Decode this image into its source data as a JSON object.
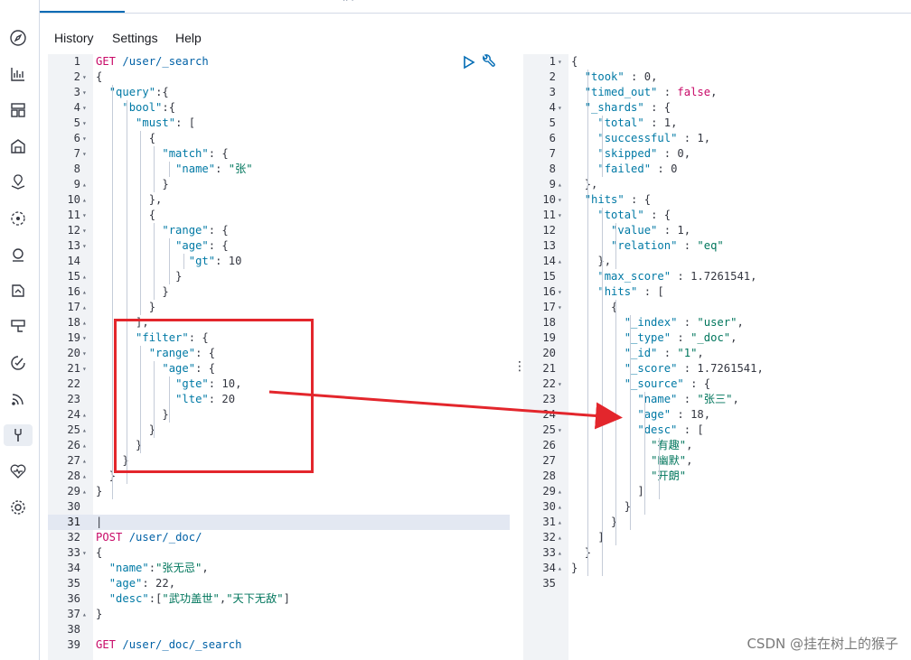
{
  "menu": {
    "history": "History",
    "settings": "Settings",
    "help": "Help"
  },
  "rail_icons": [
    "compass-icon",
    "chart-icon",
    "dashboard-icon",
    "canvas-icon",
    "maps-icon",
    "ml-icon",
    "graph-icon",
    "apm-icon",
    "uptime-icon",
    "siem-icon",
    "signals-icon",
    "devtools-icon",
    "monitoring-icon",
    "management-icon"
  ],
  "request_lines": [
    {
      "n": "1",
      "f": "",
      "html": "<span class='k'>GET</span> <span class='u'>/user/_search</span>"
    },
    {
      "n": "2",
      "f": "▾",
      "html": "<span class='p'>{</span>"
    },
    {
      "n": "3",
      "f": "▾",
      "html": "  <span class='key'>\"query\"</span><span class='p'>:{</span>"
    },
    {
      "n": "4",
      "f": "▾",
      "html": "    <span class='key'>\"bool\"</span><span class='p'>:{</span>"
    },
    {
      "n": "5",
      "f": "▾",
      "html": "      <span class='key'>\"must\"</span><span class='p'>: [</span>"
    },
    {
      "n": "6",
      "f": "▾",
      "html": "        <span class='p'>{</span>"
    },
    {
      "n": "7",
      "f": "▾",
      "html": "          <span class='key'>\"match\"</span><span class='p'>: {</span>"
    },
    {
      "n": "8",
      "f": "",
      "html": "            <span class='key'>\"name\"</span><span class='p'>: </span><span class='str'>\"张\"</span>"
    },
    {
      "n": "9",
      "f": "▴",
      "html": "          <span class='p'>}</span>"
    },
    {
      "n": "10",
      "f": "▴",
      "html": "        <span class='p'>},</span>"
    },
    {
      "n": "11",
      "f": "▾",
      "html": "        <span class='p'>{</span>"
    },
    {
      "n": "12",
      "f": "▾",
      "html": "          <span class='key'>\"range\"</span><span class='p'>: {</span>"
    },
    {
      "n": "13",
      "f": "▾",
      "html": "            <span class='key'>\"age\"</span><span class='p'>: {</span>"
    },
    {
      "n": "14",
      "f": "",
      "html": "              <span class='key'>\"gt\"</span><span class='p'>: 10</span>"
    },
    {
      "n": "15",
      "f": "▴",
      "html": "            <span class='p'>}</span>"
    },
    {
      "n": "16",
      "f": "▴",
      "html": "          <span class='p'>}</span>"
    },
    {
      "n": "17",
      "f": "▴",
      "html": "        <span class='p'>}</span>"
    },
    {
      "n": "18",
      "f": "▴",
      "html": "      <span class='p'>],</span>"
    },
    {
      "n": "19",
      "f": "▾",
      "html": "      <span class='key'>\"filter\"</span><span class='p'>: {</span>"
    },
    {
      "n": "20",
      "f": "▾",
      "html": "        <span class='key'>\"range\"</span><span class='p'>: {</span>"
    },
    {
      "n": "21",
      "f": "▾",
      "html": "          <span class='key'>\"age\"</span><span class='p'>: {</span>"
    },
    {
      "n": "22",
      "f": "",
      "html": "            <span class='key'>\"gte\"</span><span class='p'>: 10,</span>"
    },
    {
      "n": "23",
      "f": "",
      "html": "            <span class='key'>\"lte\"</span><span class='p'>: 20</span>"
    },
    {
      "n": "24",
      "f": "▴",
      "html": "          <span class='p'>}</span>"
    },
    {
      "n": "25",
      "f": "▴",
      "html": "        <span class='p'>}</span>"
    },
    {
      "n": "26",
      "f": "▴",
      "html": "      <span class='p'>}</span>"
    },
    {
      "n": "27",
      "f": "▴",
      "html": "    <span class='p'>}</span>"
    },
    {
      "n": "28",
      "f": "▴",
      "html": "  <span class='p'>}</span>"
    },
    {
      "n": "29",
      "f": "▴",
      "html": "<span class='p'>}</span>"
    },
    {
      "n": "30",
      "f": "",
      "html": ""
    },
    {
      "n": "31",
      "f": "",
      "html": "<span class='p'>|</span>",
      "cursor": true
    },
    {
      "n": "32",
      "f": "",
      "html": "<span class='k'>POST</span> <span class='u'>/user/_doc/</span>"
    },
    {
      "n": "33",
      "f": "▾",
      "html": "<span class='p'>{</span>"
    },
    {
      "n": "34",
      "f": "",
      "html": "  <span class='key'>\"name\"</span><span class='p'>:</span><span class='str'>\"张无忌\"</span><span class='p'>,</span>"
    },
    {
      "n": "35",
      "f": "",
      "html": "  <span class='key'>\"age\"</span><span class='p'>: 22,</span>"
    },
    {
      "n": "36",
      "f": "",
      "html": "  <span class='key'>\"desc\"</span><span class='p'>:[</span><span class='str'>\"武功盖世\"</span><span class='p'>,</span><span class='str'>\"天下无敌\"</span><span class='p'>]</span>"
    },
    {
      "n": "37",
      "f": "▴",
      "html": "<span class='p'>}</span>"
    },
    {
      "n": "38",
      "f": "",
      "html": ""
    },
    {
      "n": "39",
      "f": "",
      "html": "<span class='k'>GET</span> <span class='u'>/user/_doc/_search</span>"
    }
  ],
  "response_lines": [
    {
      "n": "1",
      "f": "▾",
      "html": "<span class='p'>{</span>"
    },
    {
      "n": "2",
      "f": "",
      "html": "  <span class='rkey'>\"took\"</span><span class='p'> : 0,</span>"
    },
    {
      "n": "3",
      "f": "",
      "html": "  <span class='rkey'>\"timed_out\"</span><span class='p'> : </span><span class='bool'>false</span><span class='p'>,</span>"
    },
    {
      "n": "4",
      "f": "▾",
      "html": "  <span class='rkey'>\"_shards\"</span><span class='p'> : {</span>"
    },
    {
      "n": "5",
      "f": "",
      "html": "    <span class='rkey'>\"total\"</span><span class='p'> : 1,</span>"
    },
    {
      "n": "6",
      "f": "",
      "html": "    <span class='rkey'>\"successful\"</span><span class='p'> : 1,</span>"
    },
    {
      "n": "7",
      "f": "",
      "html": "    <span class='rkey'>\"skipped\"</span><span class='p'> : 0,</span>"
    },
    {
      "n": "8",
      "f": "",
      "html": "    <span class='rkey'>\"failed\"</span><span class='p'> : 0</span>"
    },
    {
      "n": "9",
      "f": "▴",
      "html": "  <span class='p'>},</span>"
    },
    {
      "n": "10",
      "f": "▾",
      "html": "  <span class='rkey'>\"hits\"</span><span class='p'> : {</span>"
    },
    {
      "n": "11",
      "f": "▾",
      "html": "    <span class='rkey'>\"total\"</span><span class='p'> : {</span>"
    },
    {
      "n": "12",
      "f": "",
      "html": "      <span class='rkey'>\"value\"</span><span class='p'> : 1,</span>"
    },
    {
      "n": "13",
      "f": "",
      "html": "      <span class='rkey'>\"relation\"</span><span class='p'> : </span><span class='str'>\"eq\"</span>"
    },
    {
      "n": "14",
      "f": "▴",
      "html": "    <span class='p'>},</span>"
    },
    {
      "n": "15",
      "f": "",
      "html": "    <span class='rkey'>\"max_score\"</span><span class='p'> : 1.7261541,</span>"
    },
    {
      "n": "16",
      "f": "▾",
      "html": "    <span class='rkey'>\"hits\"</span><span class='p'> : [</span>"
    },
    {
      "n": "17",
      "f": "▾",
      "html": "      <span class='p'>{</span>"
    },
    {
      "n": "18",
      "f": "",
      "html": "        <span class='rkey'>\"_index\"</span><span class='p'> : </span><span class='str'>\"user\"</span><span class='p'>,</span>"
    },
    {
      "n": "19",
      "f": "",
      "html": "        <span class='rkey'>\"_type\"</span><span class='p'> : </span><span class='str'>\"_doc\"</span><span class='p'>,</span>"
    },
    {
      "n": "20",
      "f": "",
      "html": "        <span class='rkey'>\"_id\"</span><span class='p'> : </span><span class='str'>\"1\"</span><span class='p'>,</span>"
    },
    {
      "n": "21",
      "f": "",
      "html": "        <span class='rkey'>\"_score\"</span><span class='p'> : 1.7261541,</span>"
    },
    {
      "n": "22",
      "f": "▾",
      "html": "        <span class='rkey'>\"_source\"</span><span class='p'> : {</span>"
    },
    {
      "n": "23",
      "f": "",
      "html": "          <span class='rkey'>\"name\"</span><span class='p'> : </span><span class='str'>\"张三\"</span><span class='p'>,</span>"
    },
    {
      "n": "24",
      "f": "",
      "html": "          <span class='rkey'>\"age\"</span><span class='p'> : 18,</span>"
    },
    {
      "n": "25",
      "f": "▾",
      "html": "          <span class='rkey'>\"desc\"</span><span class='p'> : [</span>"
    },
    {
      "n": "26",
      "f": "",
      "html": "            <span class='str'>\"有趣\"</span><span class='p'>,</span>"
    },
    {
      "n": "27",
      "f": "",
      "html": "            <span class='str'>\"幽默\"</span><span class='p'>,</span>"
    },
    {
      "n": "28",
      "f": "",
      "html": "            <span class='str'>\"开朗\"</span>"
    },
    {
      "n": "29",
      "f": "▴",
      "html": "          <span class='p'>]</span>"
    },
    {
      "n": "30",
      "f": "▴",
      "html": "        <span class='p'>}</span>"
    },
    {
      "n": "31",
      "f": "▴",
      "html": "      <span class='p'>}</span>"
    },
    {
      "n": "32",
      "f": "▴",
      "html": "    <span class='p'>]</span>"
    },
    {
      "n": "33",
      "f": "▴",
      "html": "  <span class='p'>}</span>"
    },
    {
      "n": "34",
      "f": "▴",
      "html": "<span class='p'>}</span>"
    },
    {
      "n": "35",
      "f": "",
      "html": ""
    }
  ],
  "watermark": "CSDN @挂在树上的猴子",
  "colors": {
    "accent": "#006bb4",
    "annotation": "#e3262c"
  }
}
